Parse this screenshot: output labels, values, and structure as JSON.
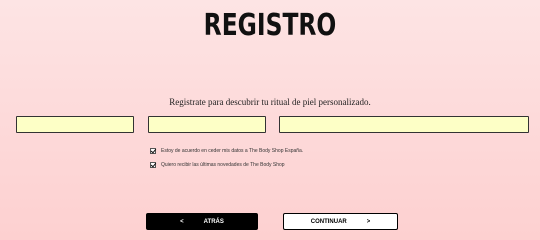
{
  "page": {
    "title": "REGISTRO",
    "subtitle": "Registrate para descubrir tu ritual de piel personalizado."
  },
  "form": {
    "fields": [
      {
        "value": ""
      },
      {
        "value": ""
      },
      {
        "value": ""
      }
    ],
    "checkboxes": [
      {
        "label": "Estoy de acuerdo en ceder mis datos a The Body Shop España.",
        "checked": true
      },
      {
        "label": "Quiero recibir las últimas novedades de The Body Shop",
        "checked": true
      }
    ]
  },
  "buttons": {
    "back_label": "ATRÁS",
    "back_arrow": "<",
    "next_label": "CONTINUAR",
    "next_arrow": ">"
  },
  "colors": {
    "background": "#fdd6d6",
    "field_fill": "#fdffc6",
    "back_button": "#000000",
    "next_button": "#ffffff"
  }
}
